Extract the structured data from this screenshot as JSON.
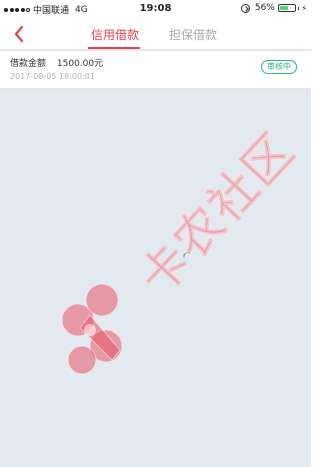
{
  "status_bar": {
    "carrier": "中国联通",
    "network": "4G",
    "time": "19:08",
    "battery_percent": "56%",
    "battery_level": 0.56,
    "signal_bars_filled": 4,
    "signal_bars_total": 5
  },
  "nav": {
    "tabs": [
      {
        "label": "信用借款",
        "active": true
      },
      {
        "label": "担保借款",
        "active": false
      }
    ]
  },
  "loan_item": {
    "amount_label": "借款金额",
    "amount_value": "1500.00元",
    "date": "2017-08-05 18:00:01",
    "status": "审核中"
  },
  "watermark": {
    "text": "卡农社区"
  },
  "colors": {
    "accent": "#e3424f",
    "status_green": "#2fb37b",
    "background": "#e3e9f0",
    "watermark": "#e85868"
  },
  "icons": {
    "back": "chevron-left-icon",
    "spinner": "loading-spinner-icon",
    "lock": "orientation-lock-icon",
    "battery": "battery-icon",
    "watermark_logo": "kanong-logo-icon"
  }
}
